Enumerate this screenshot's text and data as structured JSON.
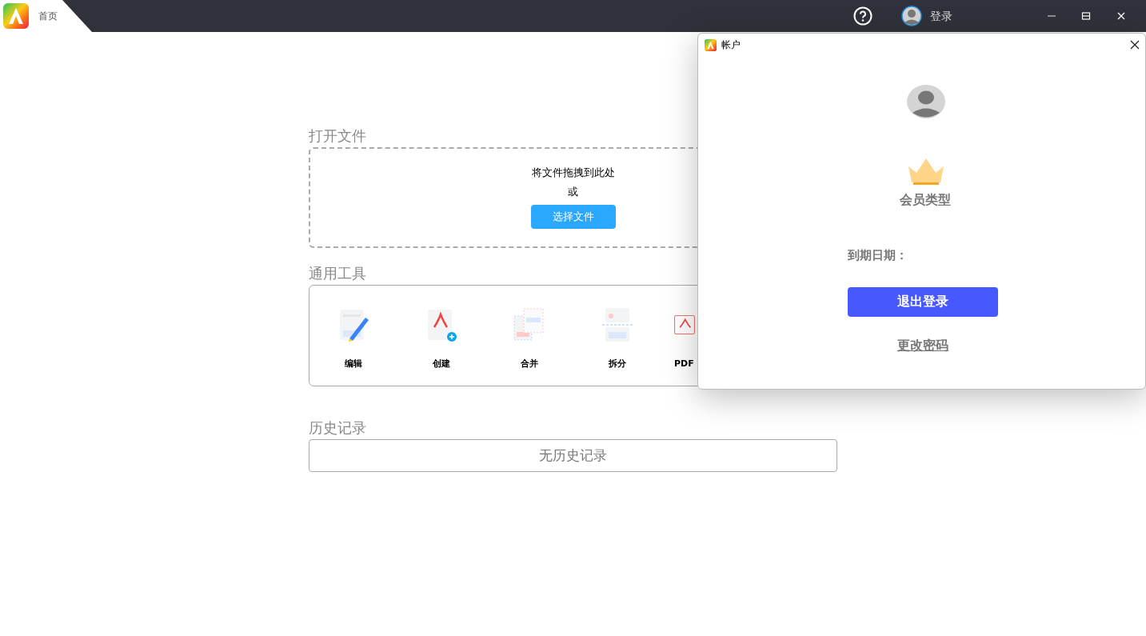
{
  "titlebar": {
    "tab": "首页",
    "login": "登录"
  },
  "open_file": {
    "heading": "打开文件",
    "drop_hint": "将文件拖拽到此处",
    "or": "或",
    "button": "选择文件"
  },
  "tools": {
    "heading": "通用工具",
    "items": [
      {
        "kind": "edit",
        "label": "编辑"
      },
      {
        "kind": "create",
        "label": "创建"
      },
      {
        "kind": "merge",
        "label": "合并"
      },
      {
        "kind": "split",
        "label": "拆分"
      },
      {
        "kind": "convert",
        "label": "PDF"
      }
    ]
  },
  "history": {
    "heading": "历史记录",
    "empty": "无历史记录"
  },
  "account_dialog": {
    "title": "帐户",
    "member_type": "会员类型",
    "expiry": "到期日期：",
    "logout": "退出登录",
    "change_password": "更改密码"
  }
}
